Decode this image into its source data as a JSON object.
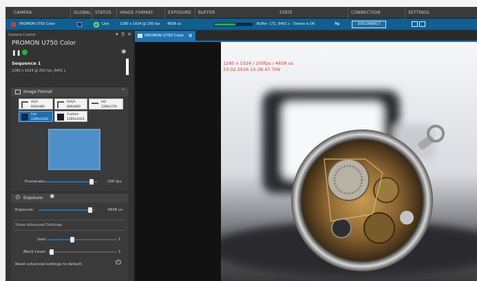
{
  "header": {
    "columns": [
      "CAMERA",
      "GLOBAL",
      "STATUS",
      "IMAGE FORMAT",
      "EXPOSURE",
      "BUFFER",
      "STATE",
      "CONNECTION",
      "SETTINGS"
    ]
  },
  "status": {
    "camera_name": "PROMON U750 Color",
    "status_text": "Live",
    "image_format": "1280 x 1024 @ 200 fps",
    "exposure": "4838 us",
    "buffer_text": "Buffer: 171, 8401 s",
    "buffer_fill_fraction": 0.55,
    "state_text": "Device is OK",
    "disconnect_label": "DISCONNECT"
  },
  "panel": {
    "title": "Camera Control",
    "camera_name": "PROMON U750 Color",
    "sequence_title": "Sequence 1",
    "sequence_sub": "1280 x 1024 @ 203 fps, 8401 s",
    "image_format": {
      "title": "Image Format",
      "formats": [
        {
          "name": "VGA",
          "size": "640x480"
        },
        {
          "name": "SVGA",
          "size": "800x600"
        },
        {
          "name": "HD",
          "size": "1280x720"
        },
        {
          "name": "Full",
          "size": "1280x1024"
        },
        {
          "name": "Custom",
          "size": "1280x1024"
        }
      ],
      "framerate_label": "Framerate:",
      "framerate_value": "200 fps",
      "framerate_fraction": 0.88
    },
    "exposure": {
      "title": "Exposure",
      "exposure_label": "Exposure:",
      "exposure_value": "4838 us",
      "exposure_fraction": 0.92,
      "advanced_label": "Show Advanced Settings",
      "gain_label": "Gain:",
      "gain_value": "1",
      "gain_fraction": 0.35,
      "black_label": "Black Level:",
      "black_value": "1",
      "black_fraction": 0.05,
      "reset_label": "Reset advanced settings to default:"
    }
  },
  "viewer": {
    "tab_label": "PROMON U750 Color",
    "overlay_line1": "1280 x 1024 / 200fps / 4838 us",
    "overlay_line2": "23.02.2016 10:28:47.709"
  },
  "colors": {
    "accent": "#1f73b3",
    "status_bar": "#115f90",
    "live_green": "#27b13b",
    "overlay_red": "#e1392b"
  },
  "icons": {
    "camera": "camera-icon",
    "live": "live-indicator-icon",
    "connection": "usb-icon",
    "settings": "window-icon",
    "reset": "power-icon",
    "gear": "gear-icon",
    "pin": "pin-icon",
    "close": "close-icon"
  }
}
